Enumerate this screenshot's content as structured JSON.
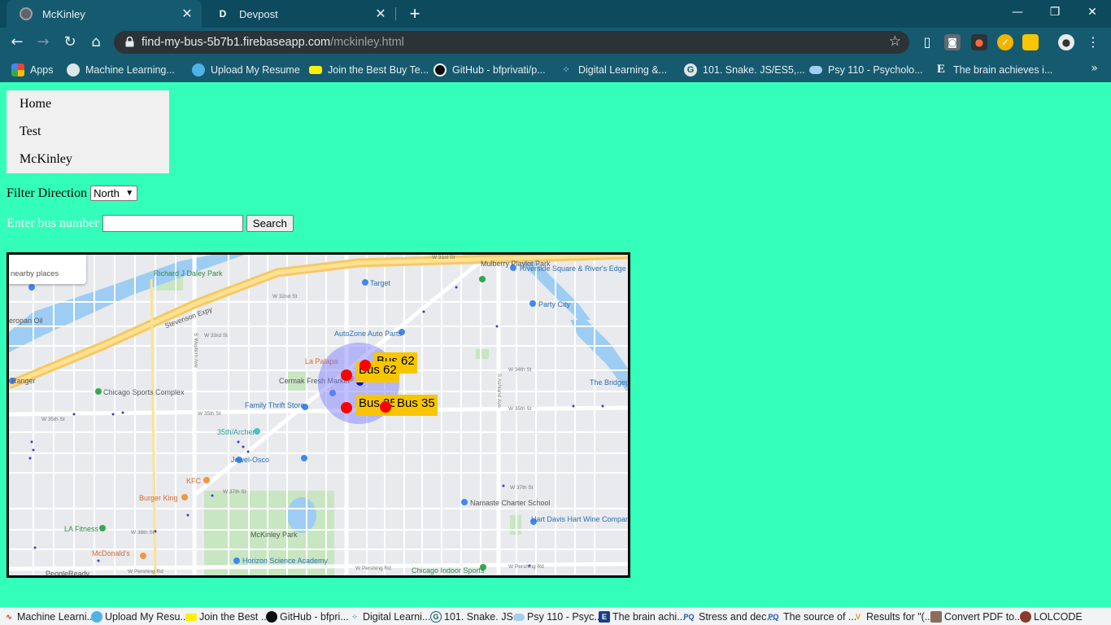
{
  "browser": {
    "tabs": [
      {
        "title": "McKinley",
        "close": "✕"
      },
      {
        "title": "Devpost",
        "favicon_letter": "D",
        "close": "✕"
      }
    ],
    "new_tab": "+",
    "window": {
      "minimize": "—",
      "restore": "❐",
      "close": "✕"
    },
    "url_host": "find-my-bus-5b7b1.firebaseapp.com",
    "url_path": "/mckinley.html",
    "bookmark_star": "☆",
    "bookmarks": [
      {
        "label": "Apps",
        "icon": "apps-grid-icon"
      },
      {
        "label": "Machine Learning...",
        "icon": "globe-icon"
      },
      {
        "label": "Upload My Resume",
        "icon": "db-icon"
      },
      {
        "label": "Join the Best Buy Te...",
        "icon": "bestbuy-tag-icon"
      },
      {
        "label": "GitHub - bfprivati/p...",
        "icon": "github-icon"
      },
      {
        "label": "Digital Learning &...",
        "icon": "dots-icon"
      },
      {
        "label": "101. Snake. JS/ES5,...",
        "icon": "g-icon"
      },
      {
        "label": "Psy 110 - Psycholo...",
        "icon": "cloud-icon"
      },
      {
        "label": "The brain achieves i...",
        "icon": "e-icon"
      }
    ],
    "bookmarks_more": "»"
  },
  "nav": {
    "items": [
      "Home",
      "Test",
      "McKinley"
    ]
  },
  "filter": {
    "label": "Filter Direction",
    "selected": "North",
    "arrow": "▼"
  },
  "search": {
    "label": "Enter bus number",
    "value": "",
    "button": "Search"
  },
  "map": {
    "search_tip": "nearby places",
    "places": [
      "Mulberry Playlot Park",
      "Riverside Square & River's Edge",
      "Richard J Daley Park",
      "Target",
      "Party City",
      "Stevenson Expy",
      "eropan Oil",
      "AutoZone Auto Parts",
      "La Palapa",
      "Cermak Fresh Market",
      "Ranger",
      "Chicago Sports Complex",
      "Family Thrift Store",
      "The Bridgeport Art Cent",
      "35th/Archer",
      "Jewel-Osco",
      "KFC",
      "Burger King",
      "Namaste Charter School",
      "Hart Davis Hart Wine Company",
      "LA Fitness",
      "McKinley Park",
      "McDonald's",
      "Horizon Science Academy",
      "Chicago Indoor Sports",
      "PeopleReady"
    ],
    "streets": [
      "W 35th St",
      "W 35th St",
      "W 35th St",
      "W 37th St",
      "W 37th St",
      "W 38th St",
      "W Pershing Rd",
      "W Pershing Rd",
      "S Western Ave",
      "S Ashland Ave",
      "W 33rd St",
      "W 34th St",
      "W 32nd St",
      "W 31st St",
      "W Pershing Rd"
    ],
    "buses": [
      {
        "label": "Bus 62"
      },
      {
        "label": "Bus 62"
      },
      {
        "label": "Bus 35"
      },
      {
        "label": "Bus 35"
      }
    ]
  },
  "footer_bookmarks": [
    {
      "label": "Machine Learni...",
      "icon": "globe-icon"
    },
    {
      "label": "Upload My Resu...",
      "icon": "db-icon"
    },
    {
      "label": "Join the Best ...",
      "icon": "bestbuy-tag-icon"
    },
    {
      "label": "GitHub - bfpri...",
      "icon": "github-icon"
    },
    {
      "label": "Digital Learni...",
      "icon": "dots-icon"
    },
    {
      "label": "101. Snake. JS...",
      "icon": "g-icon"
    },
    {
      "label": "Psy 110 - Psyc...",
      "icon": "cloud-icon"
    },
    {
      "label": "The brain achi...",
      "icon": "e-icon"
    },
    {
      "label": "Stress and dec...",
      "icon": "pq-icon"
    },
    {
      "label": "The source of ...",
      "icon": "pq-icon"
    },
    {
      "label": "Results for \"(...",
      "icon": "v-icon"
    },
    {
      "label": "Convert PDF to...",
      "icon": "doc-icon"
    },
    {
      "label": "LOLCODE",
      "icon": "lol-icon"
    }
  ],
  "colors": {
    "page_bg": "#33ffbb",
    "chrome_bg": "#165a70",
    "bus_marker": "#ff0000",
    "bus_label_bg": "#f7c600",
    "user_marker": "#0000ff"
  }
}
